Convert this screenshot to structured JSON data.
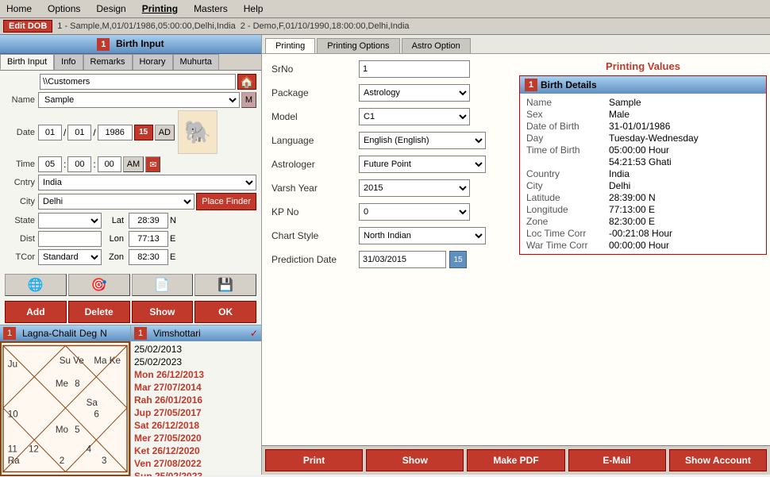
{
  "menu": {
    "items": [
      "Home",
      "Options",
      "Design",
      "Printing",
      "Masters",
      "Help"
    ]
  },
  "toolbar": {
    "edit_btn": "Edit DOB",
    "record1": "1 - Sample,M,01/01/1986,05:00:00,Delhi,India",
    "record2": "2 - Demo,F,01/10/1990,18:00:00,Delhi,India"
  },
  "left_panel": {
    "title": "Birth Input",
    "panel_num": "1",
    "tabs": [
      "Birth Input",
      "Info",
      "Remarks",
      "Horary",
      "Muhurta"
    ],
    "active_tab": "Birth Input",
    "folder_path": "\\\\Customers",
    "name_label": "Name",
    "name_value": "Sample",
    "name_btn": "M",
    "date_label": "Date",
    "date_day": "01",
    "date_month": "01",
    "date_year": "1986",
    "date_btn": "15",
    "date_ad": "AD",
    "time_label": "Time",
    "time_h": "05",
    "time_m": "00",
    "time_s": "00",
    "time_ampm": "AM",
    "cntry_label": "Cntry",
    "cntry_value": "India",
    "city_label": "City",
    "city_value": "Delhi",
    "place_finder_btn": "Place Finder",
    "state_label": "State",
    "dist_label": "Dist",
    "lat_label": "Lat",
    "lat_value": "28:39",
    "lat_dir": "N",
    "lon_label": "Lon",
    "lon_value": "77:13",
    "lon_dir": "E",
    "tcor_label": "TCor",
    "tcor_value": "Standard",
    "zon_label": "Zon",
    "zon_value": "82:30",
    "zon_dir": "E",
    "icon_btns": [
      "🌐",
      "🎯",
      "📄",
      "💾"
    ],
    "action_btns": [
      "Add",
      "Delete",
      "Show",
      "OK"
    ]
  },
  "chart_panel": {
    "title": "Lagna-Chalit",
    "deg_label": "Deg",
    "panel_num": "1",
    "num2": "N"
  },
  "vimshottari": {
    "title": "Vimshottari",
    "panel_num": "1",
    "check": "✓",
    "rows": [
      {
        "text": "25/02/2013",
        "highlight": false
      },
      {
        "text": "25/02/2023",
        "highlight": false
      },
      {
        "text": "Mon 26/12/2013",
        "highlight": true
      },
      {
        "text": "Mar 27/07/2014",
        "highlight": true
      },
      {
        "text": "Rah 26/01/2016",
        "highlight": true
      },
      {
        "text": "Jup 27/05/2017",
        "highlight": true
      },
      {
        "text": "Sat 26/12/2018",
        "highlight": true
      },
      {
        "text": "Mer 27/05/2020",
        "highlight": true
      },
      {
        "text": "Ket 26/12/2020",
        "highlight": true
      },
      {
        "text": "Ven 27/08/2022",
        "highlight": true
      },
      {
        "text": "Sun 25/02/2023",
        "highlight": true
      }
    ]
  },
  "printing_tabs": [
    "Printing",
    "Printing Options",
    "Astro Option"
  ],
  "active_printing_tab": "Printing",
  "printing_values_title": "Printing Values",
  "form_fields": {
    "srno_label": "SrNo",
    "srno_value": "1",
    "package_label": "Package",
    "package_value": "Astrology",
    "model_label": "Model",
    "model_value": "C1",
    "language_label": "Language",
    "language_value": "English (English)",
    "astrologer_label": "Astrologer",
    "astrologer_value": "Future Point",
    "varsh_year_label": "Varsh Year",
    "varsh_year_value": "2015",
    "kp_no_label": "KP No",
    "kp_no_value": "0",
    "chart_style_label": "Chart Style",
    "chart_style_value": "North Indian",
    "prediction_date_label": "Prediction Date",
    "prediction_date_value": "31/03/2015",
    "prediction_date_btn": "15"
  },
  "birth_details": {
    "panel_num": "1",
    "title": "Birth Details",
    "printing_values": "Printing Values",
    "fields": [
      {
        "key": "Name",
        "value": "Sample"
      },
      {
        "key": "Sex",
        "value": "Male"
      },
      {
        "key": "Date of Birth",
        "value": "31-01/01/1986"
      },
      {
        "key": "Day",
        "value": "Tuesday-Wednesday"
      },
      {
        "key": "Time of Birth",
        "value": "05:00:00 Hour"
      },
      {
        "key": "",
        "value": "54:21:53 Ghati"
      },
      {
        "key": "Country",
        "value": "India"
      },
      {
        "key": "City",
        "value": "Delhi"
      },
      {
        "key": "Latitude",
        "value": "28:39:00 N"
      },
      {
        "key": "Longitude",
        "value": "77:13:00 E"
      },
      {
        "key": "Zone",
        "value": "82:30:00 E"
      },
      {
        "key": "Loc Time Corr",
        "value": "-00:21:08 Hour"
      },
      {
        "key": "War Time Corr",
        "value": "00:00:00 Hour"
      }
    ]
  },
  "bottom_buttons": [
    "Print",
    "Show",
    "Make PDF",
    "E-Mail",
    "Show Account"
  ],
  "lagna_chart": {
    "cells": [
      {
        "pos": "top-left",
        "content": ""
      },
      {
        "pos": "top",
        "content": ""
      },
      {
        "pos": "top-right",
        "content": ""
      },
      {
        "pos": "left",
        "content": "Ra"
      },
      {
        "pos": "center",
        "content": ""
      },
      {
        "pos": "right",
        "content": ""
      },
      {
        "pos": "bottom-left",
        "content": "Ra"
      },
      {
        "pos": "bottom",
        "content": ""
      },
      {
        "pos": "bottom-right",
        "content": ""
      }
    ],
    "planets": {
      "su": "Su",
      "ve": "Ve",
      "ma": "Ma",
      "ke": "Ke",
      "ju": "Ju",
      "me": "Me",
      "sa": "Sa",
      "mo": "Mo"
    }
  }
}
